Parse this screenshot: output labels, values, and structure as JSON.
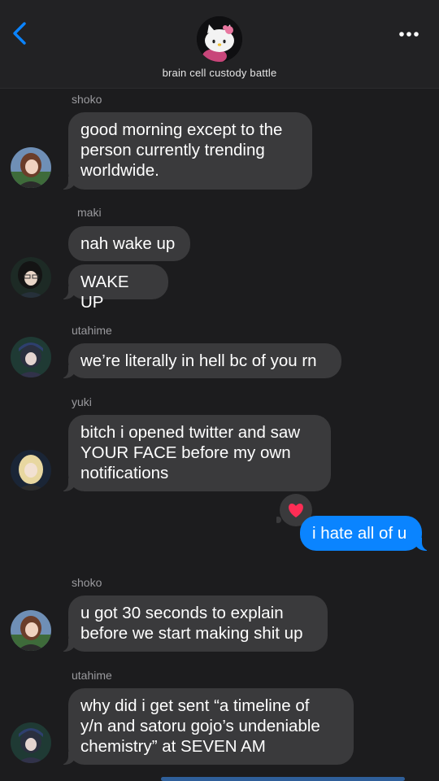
{
  "header": {
    "group_name": "brain cell custody battle",
    "avatar_icon": "hello-kitty-avatar",
    "back_icon": "chevron-left-icon",
    "more_icon": "ellipsis-icon",
    "accent_color": "#0a84ff"
  },
  "messages": [
    {
      "sender": "shoko",
      "lines": [
        "good morning except to the",
        "person currently trending",
        "worldwide."
      ]
    },
    {
      "sender": "maki",
      "texts": [
        "nah wake up",
        "WAKE UP"
      ]
    },
    {
      "sender": "utahime",
      "lines": [
        "we’re literally in hell bc of you rn"
      ]
    },
    {
      "sender": "yuki",
      "lines": [
        "bitch i opened twitter and saw",
        "YOUR FACE before my own",
        "notifications"
      ]
    },
    {
      "sender": "me",
      "lines": [
        "i hate all of u"
      ],
      "reaction": "heart-icon"
    },
    {
      "sender": "shoko",
      "lines": [
        "u got 30 seconds to explain",
        "before we start making shit up"
      ]
    },
    {
      "sender": "utahime",
      "lines": [
        "why did i get sent “a timeline of",
        "y/n and satoru gojo’s undeniable",
        "chemistry” at SEVEN AM"
      ]
    }
  ]
}
